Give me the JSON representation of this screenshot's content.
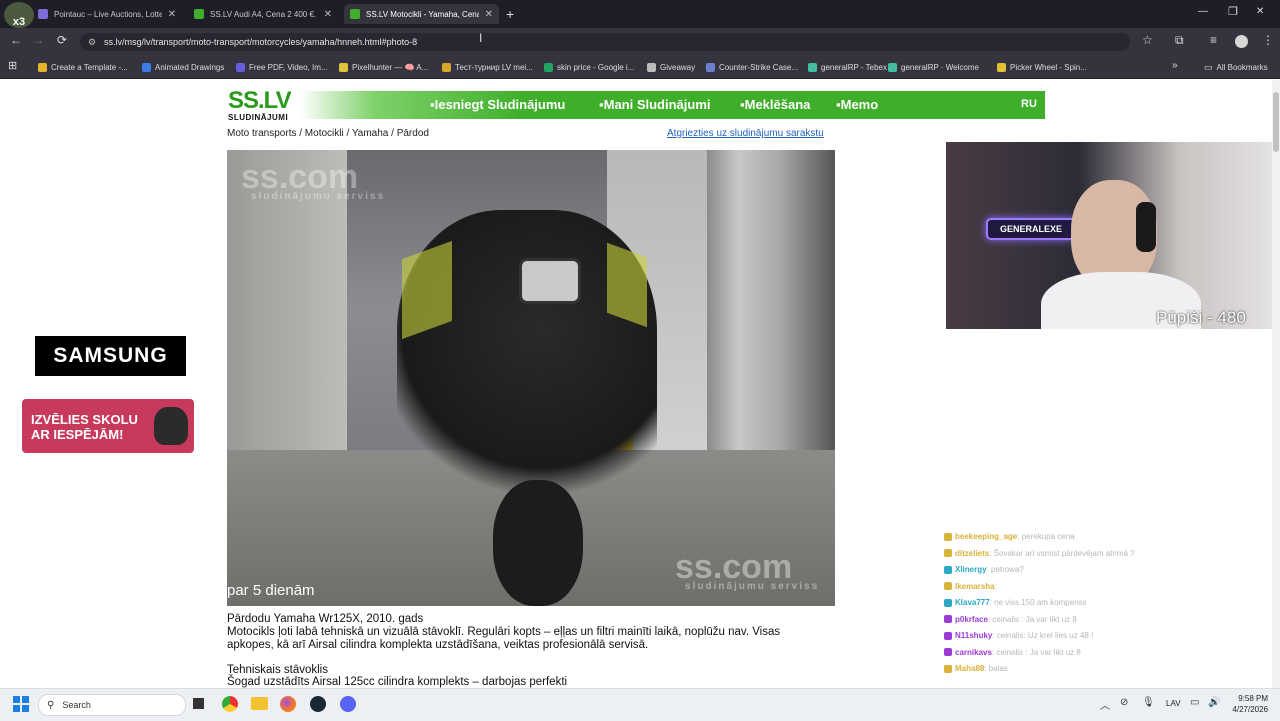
{
  "browser": {
    "tabs": [
      {
        "title": "Pointauc – Live Auctions, Lotter",
        "fav_color": "#7b6cd9"
      },
      {
        "title": "SS.LV Audi A4, Cena 2 400 €. S",
        "fav_color": "#3fae2a"
      },
      {
        "title": "SS.LV Motocikli - Yamaha, Cena",
        "fav_color": "#3fae2a"
      }
    ],
    "new_tab": "+",
    "tab_close": "✕",
    "url": "ss.lv/msg/lv/transport/moto-transport/motorcycles/yamaha/hnneh.html#photo-8",
    "bookmarks": [
      {
        "label": "Create a Template -...",
        "color": "#e8b52a"
      },
      {
        "label": "Animated Drawings",
        "color": "#3b7bea"
      },
      {
        "label": "Free PDF, Video, Im...",
        "color": "#6a5ae0"
      },
      {
        "label": "Pixelhunter — 🧠 A...",
        "color": "#e0c23a"
      },
      {
        "label": "Тест-турнир LV mei...",
        "color": "#d9a52a"
      },
      {
        "label": "skin price - Google i...",
        "color": "#1ea362"
      },
      {
        "label": "Giveaway",
        "color": "#bbbbbb"
      },
      {
        "label": "Counter-Strike Case...",
        "color": "#6a7fd0"
      },
      {
        "label": "generalRP - Tebex",
        "color": "#3fbf9f"
      },
      {
        "label": "generalRP · Welcome",
        "color": "#3fbf9f"
      },
      {
        "label": "Picker Wheel - Spin...",
        "color": "#e2c030"
      }
    ],
    "all_bookmarks": "All Bookmarks",
    "window_controls": [
      "—",
      "❐",
      "✕"
    ]
  },
  "site": {
    "logo": "SS.LV",
    "logo_sub": "SLUDINĀJUMI",
    "nav": [
      "Iesniegt Sludinājumu",
      "Mani Sludinājumi",
      "Meklēšana",
      "Memo"
    ],
    "lang": "RU",
    "breadcrumb": "Moto transports / Motocikli / Yamaha / Pārdod",
    "back_link": "Atgriezties uz sludinājumu sarakstu",
    "watermark": "ss.com",
    "watermark_sub": "sludinājumu serviss",
    "photo_caption": "par 5 dienām",
    "desc_title": "Pārdodu Yamaha Wr125X, 2010. gads",
    "desc_body": "Motocikls ļoti labā tehniskā un vizuālā stāvoklī. Regulāri kopts – eļļas un filtri mainīti laikā, noplūžu nav. Visas apkopes, kā arī Airsal cilindra komplekta uzstādīšana, veiktas profesionālā servisā.",
    "tech_title": "Tehniskais stāvoklis",
    "tech_line": "Šogad uzstādīts Airsal 125cc cilindra komplekts – darbojas perfekti"
  },
  "ads": {
    "samsung": "SAMSUNG",
    "loan_line1": "IZVĒLIES SKOLU",
    "loan_line2": "AR IESPĒJĀM!"
  },
  "stream": {
    "neon": "GENERALEXE",
    "counter": "Pūpiši - 480",
    "chat": [
      {
        "user": "beekeeping_age",
        "msg": ": perekupa cena",
        "color": "#d9b23a"
      },
      {
        "user": "ditzeliets",
        "msg": ": Šovakar arī vsmist pārdevējam atrimā ?",
        "color": "#d9b23a"
      },
      {
        "user": "Xlinergy",
        "msg": ": petrowa?",
        "color": "#2aa9c6"
      },
      {
        "user": "Ikemarsha",
        "msg": ":",
        "color": "#d9b23a"
      },
      {
        "user": "Klava777",
        "msg": ": ne viss 150 am kompenss",
        "color": "#2aa9c6"
      },
      {
        "user": "p0krface",
        "msg": ": ceinalis : Ja var likt uz 8",
        "color": "#9a3bd6"
      },
      {
        "user": "N11shuky",
        "msg": ": ceinalis: Uz krei lies uz 48 !",
        "color": "#9a3bd6"
      },
      {
        "user": "carnikavs",
        "msg": ": ceinalis : Ja var likt uz 8",
        "color": "#9a3bd6"
      },
      {
        "user": "Maha88",
        "msg": ": balas",
        "color": "#d9b23a"
      }
    ]
  },
  "taskbar": {
    "search": "Search",
    "lang": "LAV",
    "time": "9:58 PM",
    "date": "4/27/2026"
  }
}
